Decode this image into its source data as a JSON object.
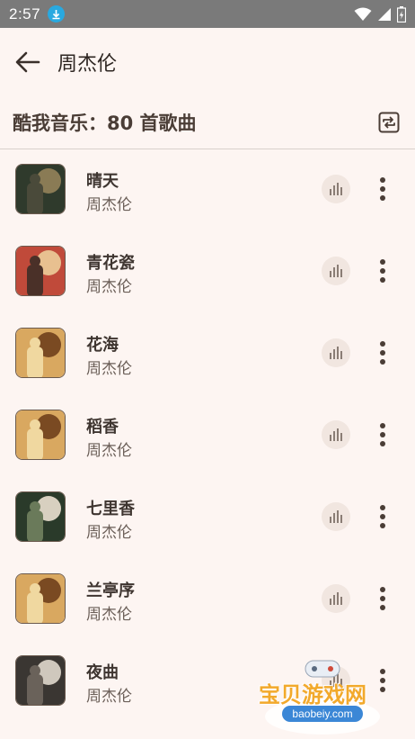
{
  "status_bar": {
    "time": "2:57"
  },
  "app_bar": {
    "title": "周杰伦",
    "back_icon": "arrow-back-icon"
  },
  "header": {
    "text": "酷我音乐：80 首歌曲",
    "repeat_icon": "repeat-icon"
  },
  "songs": [
    {
      "title": "晴天",
      "artist": "周杰伦",
      "cover_colors": [
        "#2f3a2c",
        "#8a7b55",
        "#4a4a3a"
      ]
    },
    {
      "title": "青花瓷",
      "artist": "周杰伦",
      "cover_colors": [
        "#c04a3a",
        "#e8c090",
        "#4a3028"
      ]
    },
    {
      "title": "花海",
      "artist": "周杰伦",
      "cover_colors": [
        "#d9a860",
        "#7a4a22",
        "#f0d8a0"
      ]
    },
    {
      "title": "稻香",
      "artist": "周杰伦",
      "cover_colors": [
        "#d9a860",
        "#7a4a22",
        "#f0d8a0"
      ]
    },
    {
      "title": "七里香",
      "artist": "周杰伦",
      "cover_colors": [
        "#2a3a2a",
        "#d8d0c0",
        "#6a7a5a"
      ]
    },
    {
      "title": "兰亭序",
      "artist": "周杰伦",
      "cover_colors": [
        "#d9a860",
        "#7a4a22",
        "#f0d8a0"
      ]
    },
    {
      "title": "夜曲",
      "artist": "周杰伦",
      "cover_colors": [
        "#3a3632",
        "#cfc8bd",
        "#6a625a"
      ]
    }
  ],
  "watermark": {
    "text": "宝贝游戏网",
    "url": "baobeiy.com"
  },
  "colors": {
    "background": "#fdf5f2",
    "status_bar": "#7a7a7a",
    "accent_text": "#4a3d36"
  }
}
